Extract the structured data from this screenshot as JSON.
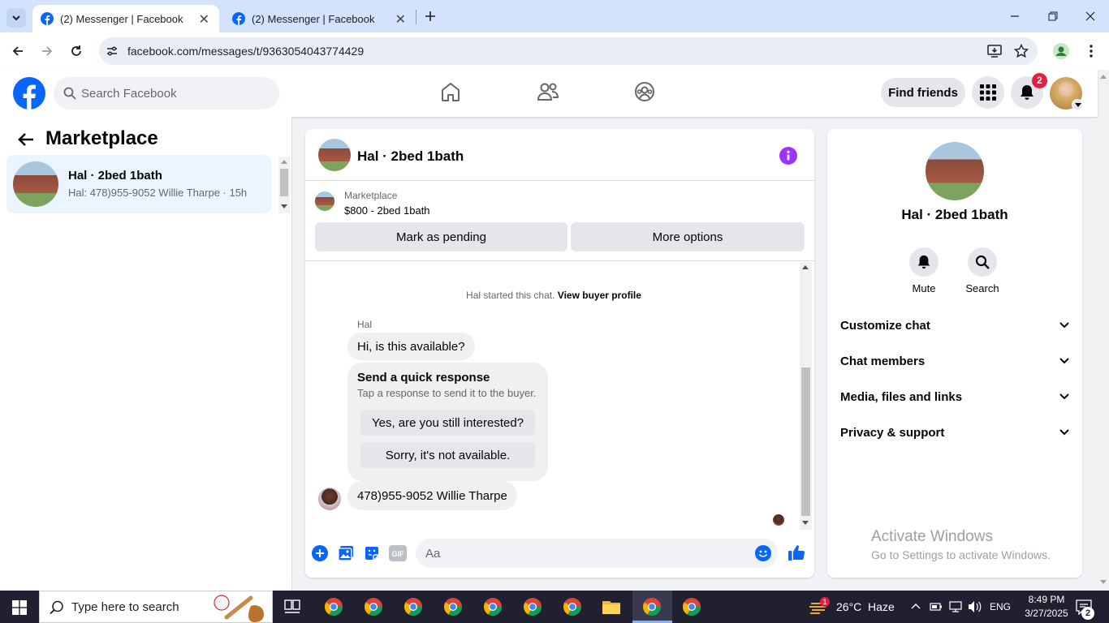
{
  "browser": {
    "tabs": [
      {
        "title": "(2) Messenger | Facebook",
        "active": true
      },
      {
        "title": "(2) Messenger | Facebook",
        "active": false
      }
    ],
    "url": "facebook.com/messages/t/9363054043774429"
  },
  "fb_header": {
    "search_placeholder": "Search Facebook",
    "find_friends": "Find friends",
    "notification_count": "2",
    "brand_color": "#0866ff"
  },
  "left_panel": {
    "title": "Marketplace",
    "conversations": [
      {
        "name": "Hal · 2bed 1bath",
        "snippet": "Hal: 478)955-9052 Willie Tharpe · 15h"
      }
    ]
  },
  "chat": {
    "title": "Hal · 2bed 1bath",
    "marketplace_label": "Marketplace",
    "listing": "$800 - 2bed 1bath",
    "mark_pending": "Mark as pending",
    "more_options": "More options",
    "system_msg": "Hal started this chat.",
    "view_profile": "View buyer profile",
    "sender": "Hal",
    "msg1": "Hi, is this available?",
    "quick_title": "Send a quick response",
    "quick_sub": "Tap a response to send it to the buyer.",
    "quick1": "Yes, are you still interested?",
    "quick2": "Sorry, it's not available.",
    "msg2": "478)955-9052 Willie Tharpe",
    "input_placeholder": "Aa"
  },
  "info_panel": {
    "name": "Hal · 2bed 1bath",
    "mute": "Mute",
    "search": "Search",
    "sections": [
      "Customize chat",
      "Chat members",
      "Media, files and links",
      "Privacy & support"
    ]
  },
  "watermark": {
    "line1": "Activate Windows",
    "line2": "Go to Settings to activate Windows."
  },
  "taskbar": {
    "search_placeholder": "Type here to search",
    "weather": "26°C  Haze",
    "weather_badge": "1",
    "lang": "ENG",
    "time": "8:49 PM",
    "date": "3/27/2025",
    "notif": "2"
  }
}
